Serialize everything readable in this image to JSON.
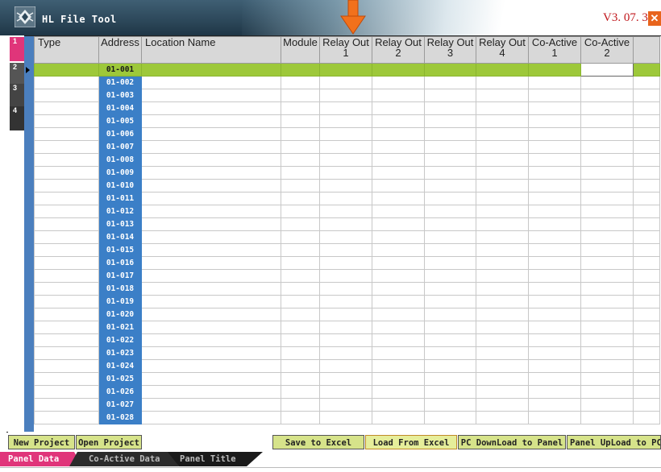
{
  "app": {
    "title": "HL File Tool",
    "version": "V3. 07. 3",
    "close_glyph": "✕",
    "logo_icon": "hl-logo-icon",
    "annotation_icon": "orange-down-arrow-icon"
  },
  "colors": {
    "selected_row": "#9dc83a",
    "address_cell": "#3b7fc7",
    "button": "#d6e38a",
    "active_tab": "#e0357a"
  },
  "side_tabs": [
    "1",
    "2",
    "3",
    "4"
  ],
  "grid": {
    "columns": [
      {
        "line1": "Type",
        "line2": ""
      },
      {
        "line1": "Address",
        "line2": ""
      },
      {
        "line1": "Location Name",
        "line2": ""
      },
      {
        "line1": "Module",
        "line2": ""
      },
      {
        "line1": "Relay Out",
        "line2": "1"
      },
      {
        "line1": "Relay Out",
        "line2": "2"
      },
      {
        "line1": "Relay Out",
        "line2": "3"
      },
      {
        "line1": "Relay Out",
        "line2": "4"
      },
      {
        "line1": "Co-Active",
        "line2": "1"
      },
      {
        "line1": "Co-Active",
        "line2": "2"
      }
    ],
    "addresses": [
      "01-001",
      "01-002",
      "01-003",
      "01-004",
      "01-005",
      "01-006",
      "01-007",
      "01-008",
      "01-009",
      "01-010",
      "01-011",
      "01-012",
      "01-013",
      "01-014",
      "01-015",
      "01-016",
      "01-017",
      "01-018",
      "01-019",
      "01-020",
      "01-021",
      "01-022",
      "01-023",
      "01-024",
      "01-025",
      "01-026",
      "01-027",
      "01-028"
    ],
    "selected_row": 0
  },
  "buttons": {
    "new_project": "New Project",
    "open_project": "Open Project",
    "save_to_excel": "Save  to Excel",
    "load_from_excel": "Load  From Excel",
    "pc_download": "PC DownLoad to Panel",
    "panel_upload": "Panel UpLoad to PC"
  },
  "bottom_tabs": [
    "Panel Data",
    "Co-Active Data",
    "Panel Title"
  ],
  "active_bottom_tab": 0
}
